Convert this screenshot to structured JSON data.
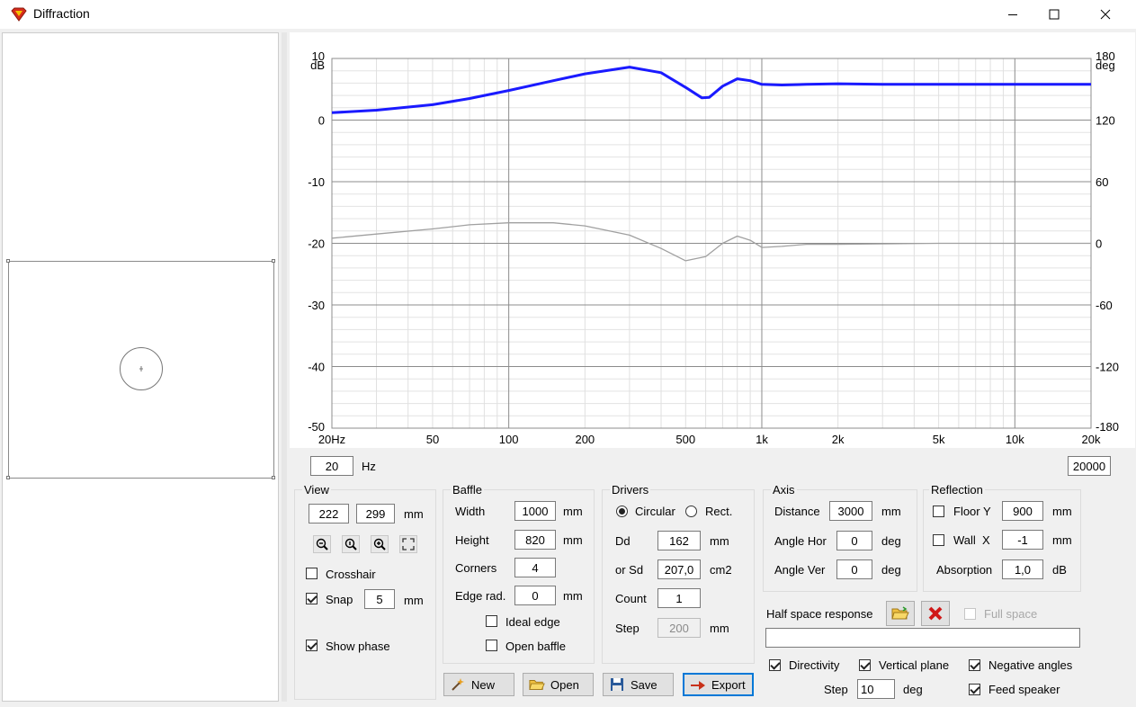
{
  "window": {
    "title": "Diffraction"
  },
  "chart_data": {
    "type": "line",
    "xscale": "log",
    "xlim": [
      20,
      20000
    ],
    "x_ticks": [
      "20Hz",
      "50",
      "100",
      "200",
      "500",
      "1k",
      "2k",
      "5k",
      "10k",
      "20k"
    ],
    "left_axis": {
      "unit": "dB",
      "ylim": [
        -50,
        10
      ],
      "ticks": [
        "10",
        "0",
        "-10",
        "-20",
        "-30",
        "-40",
        "-50"
      ]
    },
    "right_axis": {
      "unit": "deg",
      "ylim": [
        -180,
        180
      ],
      "ticks": [
        "180",
        "120",
        "60",
        "0",
        "-60",
        "-120",
        "-180"
      ]
    },
    "grid": true,
    "series": [
      {
        "color": "#1a1aff",
        "axis": "left",
        "x": [
          20,
          30,
          50,
          70,
          100,
          150,
          200,
          300,
          400,
          500,
          580,
          620,
          700,
          800,
          900,
          1000,
          1200,
          1500,
          2000,
          3000,
          5000,
          7000,
          10000,
          20000
        ],
        "y": [
          1.2,
          1.6,
          2.5,
          3.5,
          4.8,
          6.4,
          7.5,
          8.6,
          7.7,
          5.3,
          3.6,
          3.7,
          5.5,
          6.7,
          6.4,
          5.8,
          5.7,
          5.8,
          5.9,
          5.8,
          5.8,
          5.8,
          5.8,
          5.8
        ]
      },
      {
        "color": "#a0a0a0",
        "axis": "right",
        "x": [
          20,
          30,
          50,
          70,
          100,
          150,
          200,
          300,
          400,
          500,
          600,
          700,
          800,
          900,
          1000,
          1200,
          1500,
          2000,
          5000,
          10000,
          20000
        ],
        "y": [
          5,
          9,
          14,
          18,
          20,
          20,
          17,
          8,
          -5,
          -17,
          -13,
          0,
          7,
          3,
          -4,
          -3,
          -1,
          -1,
          0,
          0,
          0
        ]
      }
    ]
  },
  "freq_range": {
    "min": "20",
    "unit": "Hz",
    "max": "20000"
  },
  "view": {
    "title": "View",
    "x": "222",
    "y": "299",
    "unit": "mm",
    "crosshair_label": "Crosshair",
    "snap_label": "Snap",
    "snap_value": "5",
    "snap_unit": "mm",
    "show_phase_label": "Show phase"
  },
  "baffle": {
    "title": "Baffle",
    "width_label": "Width",
    "width": "1000",
    "width_unit": "mm",
    "height_label": "Height",
    "height": "820",
    "height_unit": "mm",
    "corners_label": "Corners",
    "corners": "4",
    "edge_label": "Edge rad.",
    "edge": "0",
    "edge_unit": "mm",
    "ideal_edge_label": "Ideal edge",
    "open_baffle_label": "Open baffle"
  },
  "drivers": {
    "title": "Drivers",
    "circular_label": "Circular",
    "rect_label": "Rect.",
    "dd_label": "Dd",
    "dd": "162",
    "dd_unit": "mm",
    "sd_label": "or Sd",
    "sd": "207,0",
    "sd_unit": "cm2",
    "count_label": "Count",
    "count": "1",
    "step_label": "Step",
    "step": "200",
    "step_unit": "mm"
  },
  "axis": {
    "title": "Axis",
    "distance_label": "Distance",
    "distance": "3000",
    "distance_unit": "mm",
    "hor_label": "Angle Hor",
    "hor": "0",
    "hor_unit": "deg",
    "ver_label": "Angle Ver",
    "ver": "0",
    "ver_unit": "deg"
  },
  "reflection": {
    "title": "Reflection",
    "floor_label": "Floor Y",
    "floor": "900",
    "floor_unit": "mm",
    "wall_label": "Wall  X",
    "wall": "-1",
    "wall_unit": "mm",
    "absorption_label": "Absorption",
    "absorption": "1,0",
    "absorption_unit": "dB"
  },
  "half_space": {
    "label": "Half space response",
    "full_space_label": "Full space",
    "path": ""
  },
  "directivity": {
    "directivity_label": "Directivity",
    "vertical_label": "Vertical plane",
    "negative_label": "Negative angles",
    "step_label": "Step",
    "step": "10",
    "step_unit": "deg",
    "feed_label": "Feed speaker"
  },
  "buttons": {
    "new": "New",
    "open": "Open",
    "save": "Save",
    "export": "Export"
  }
}
